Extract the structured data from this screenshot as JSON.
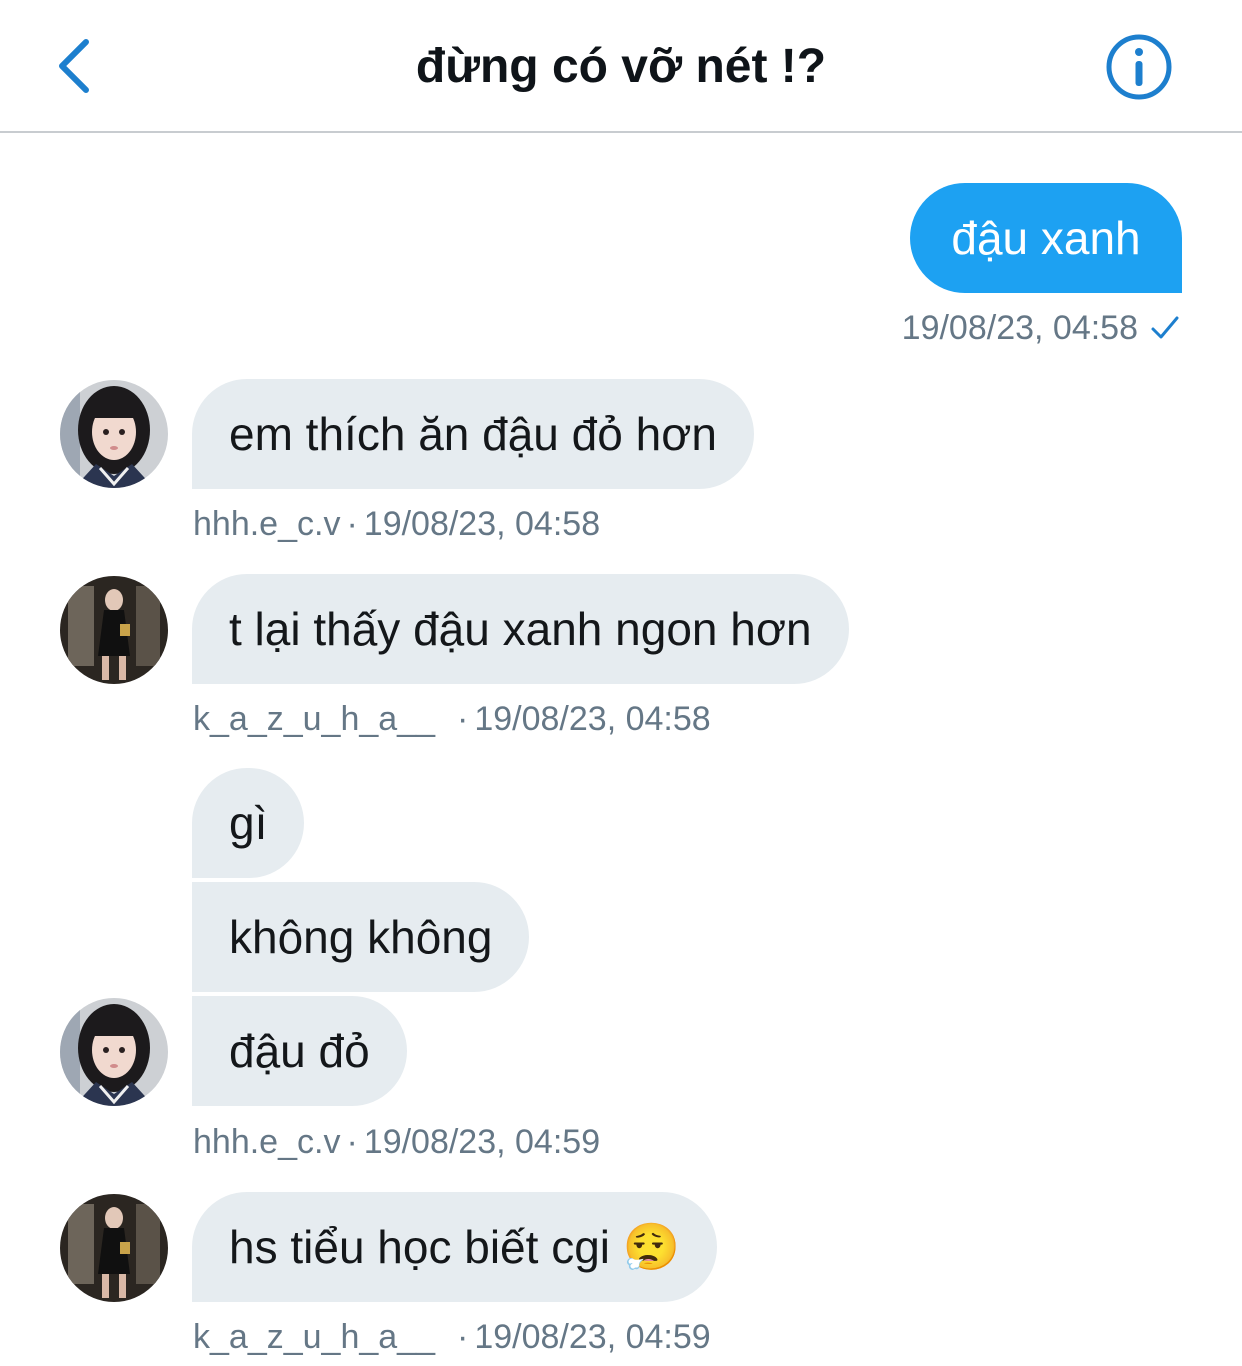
{
  "header": {
    "title": "đừng có vỡ nét !?",
    "back_icon": "chevron-left-icon",
    "info_icon": "info-icon",
    "accent_color": "#1d7fce"
  },
  "messages": [
    {
      "direction": "outgoing",
      "text": "đậu xanh",
      "timestamp": "19/08/23, 04:58",
      "status_icon": "checkmark-icon"
    },
    {
      "direction": "incoming",
      "sender": "hhh.e_c.v",
      "text": "em thích ăn đậu đỏ hơn",
      "timestamp": "19/08/23, 04:58"
    },
    {
      "direction": "incoming",
      "sender": "k_a_z_u_h_a__",
      "text": "t lại thấy đậu xanh ngon hơn",
      "timestamp": "19/08/23, 04:58"
    },
    {
      "direction": "incoming",
      "sender": "hhh.e_c.v",
      "texts": [
        "gì",
        "không không",
        "đậu đỏ"
      ],
      "timestamp": "19/08/23, 04:59"
    },
    {
      "direction": "incoming",
      "sender": "k_a_z_u_h_a__",
      "text": "hs tiểu học biết cgi 😮‍💨",
      "timestamp": "19/08/23, 04:59"
    }
  ],
  "meta_separator": "·",
  "colors": {
    "outgoing_bubble": "#1da1f2",
    "incoming_bubble": "#e6ecf0",
    "meta_text": "#657786"
  }
}
